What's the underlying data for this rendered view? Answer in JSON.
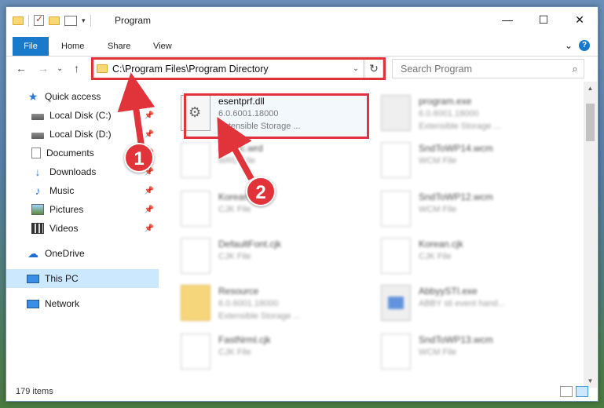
{
  "window": {
    "title": "Program",
    "controls": {
      "minimize": "—",
      "maximize": "☐",
      "close": "✕"
    }
  },
  "ribbon": {
    "tabs": [
      "File",
      "Home",
      "Share",
      "View"
    ],
    "expand": "⌄",
    "help": "?"
  },
  "nav": {
    "back": "←",
    "forward": "→",
    "recent": "⌄",
    "up": "↑",
    "address": "C:\\Program Files\\Program Directory",
    "address_caret": "⌄",
    "refresh": "↻",
    "search_placeholder": "Search Program",
    "search_icon": "⌕"
  },
  "sidebar": {
    "items": [
      {
        "label": "Quick access",
        "icon": "star-icon",
        "pinned": false
      },
      {
        "label": "Local Disk (C:)",
        "icon": "disk-icon",
        "pinned": true
      },
      {
        "label": "Local Disk (D:)",
        "icon": "disk-icon",
        "pinned": true
      },
      {
        "label": "Documents",
        "icon": "document-icon",
        "pinned": true
      },
      {
        "label": "Downloads",
        "icon": "download-icon",
        "pinned": true
      },
      {
        "label": "Music",
        "icon": "music-icon",
        "pinned": true
      },
      {
        "label": "Pictures",
        "icon": "pictures-icon",
        "pinned": true
      },
      {
        "label": "Videos",
        "icon": "videos-icon",
        "pinned": true
      },
      {
        "label": "OneDrive",
        "icon": "cloud-icon",
        "pinned": false
      },
      {
        "label": "This PC",
        "icon": "computer-icon",
        "pinned": false,
        "selected": true
      },
      {
        "label": "Network",
        "icon": "network-icon",
        "pinned": false
      }
    ],
    "pin_glyph": "📌"
  },
  "files": [
    {
      "name": "esentprf.dll",
      "line2": "6.0.6001.18000",
      "line3": "Extensible Storage ...",
      "icon": "dll",
      "highlighted": true
    },
    {
      "name": "program.exe",
      "line2": "6.0.6001.18000",
      "line3": "Extensible Storage ...",
      "icon": "exe"
    },
    {
      "name": "Arabic.wrd",
      "line2": "WRD File",
      "line3": "",
      "icon": "generic"
    },
    {
      "name": "SndToWP14.wcm",
      "line2": "WCM File",
      "line3": "",
      "icon": "generic"
    },
    {
      "name": "Korean.cjk",
      "line2": "CJK File",
      "line3": "",
      "icon": "generic"
    },
    {
      "name": "SndToWP12.wcm",
      "line2": "WCM File",
      "line3": "",
      "icon": "generic"
    },
    {
      "name": "DefaultFont.cjk",
      "line2": "CJK File",
      "line3": "",
      "icon": "generic"
    },
    {
      "name": "Korean.cjk",
      "line2": "CJK File",
      "line3": "",
      "icon": "generic"
    },
    {
      "name": "Resource",
      "line2": "6.0.6001.18000",
      "line3": "Extensible Storage ...",
      "icon": "folder"
    },
    {
      "name": "AbbyySTI.exe",
      "line2": "ABBY sti event hand...",
      "line3": "",
      "icon": "exe-blue"
    },
    {
      "name": "FastNrml.cjk",
      "line2": "CJK File",
      "line3": "",
      "icon": "generic"
    },
    {
      "name": "SndToWP13.wcm",
      "line2": "WCM File",
      "line3": "",
      "icon": "generic"
    }
  ],
  "status": {
    "count": "179 items"
  },
  "annotations": {
    "one": "1",
    "two": "2"
  },
  "colors": {
    "highlight_red": "#e0333a",
    "accent_blue": "#1979ca"
  }
}
